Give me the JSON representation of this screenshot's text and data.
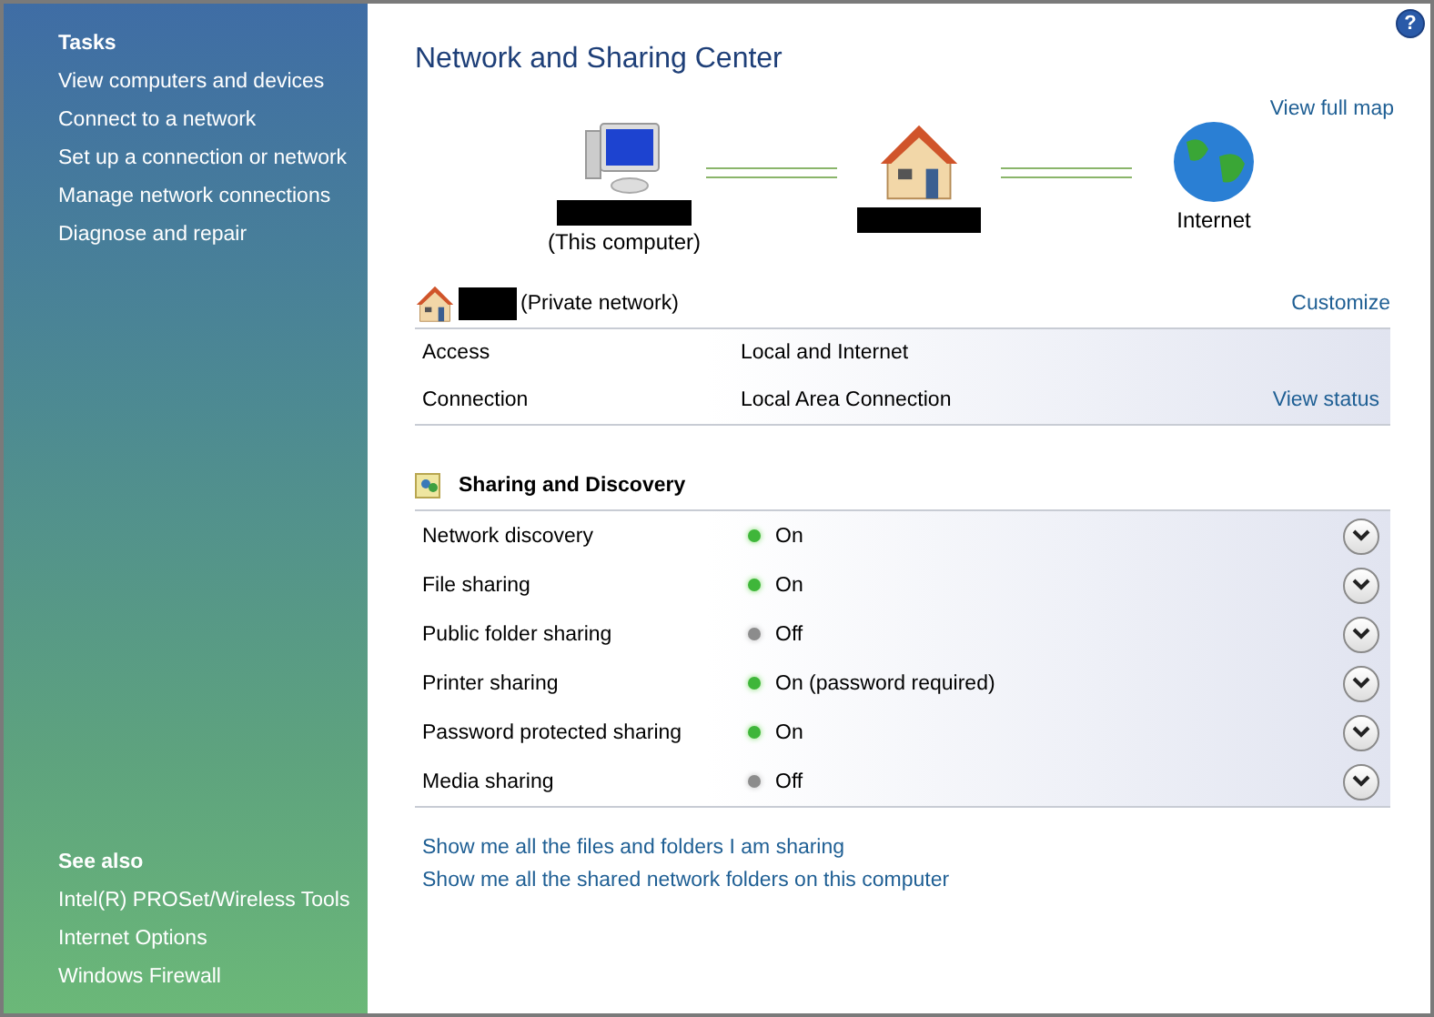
{
  "sidebar": {
    "tasks_heading": "Tasks",
    "tasks": [
      "View computers and devices",
      "Connect to a network",
      "Set up a connection or network",
      "Manage network connections",
      "Diagnose and repair"
    ],
    "see_also_heading": "See also",
    "see_also": [
      "Intel(R) PROSet/Wireless Tools",
      "Internet Options",
      "Windows Firewall"
    ]
  },
  "help": "?",
  "title": "Network and Sharing Center",
  "map": {
    "link": "View full map",
    "this_computer": "(This computer)",
    "internet": "Internet"
  },
  "network": {
    "type": "(Private network)",
    "customize": "Customize",
    "rows": [
      {
        "label": "Access",
        "value": "Local and Internet"
      },
      {
        "label": "Connection",
        "value": "Local Area Connection",
        "link": "View status"
      }
    ]
  },
  "sharing": {
    "heading": "Sharing and Discovery",
    "items": [
      {
        "label": "Network discovery",
        "status": "On",
        "on": true,
        "expanded": false
      },
      {
        "label": "File sharing",
        "status": "On",
        "on": true,
        "expanded": false
      },
      {
        "label": "Public folder sharing",
        "status": "Off",
        "on": false,
        "expanded": false
      },
      {
        "label": "Printer sharing",
        "status": "On (password required)",
        "on": true,
        "expanded": false
      },
      {
        "label": "Password protected sharing",
        "status": "On",
        "on": true,
        "expanded": false
      },
      {
        "label": "Media sharing",
        "status": "Off",
        "on": false,
        "expanded": false
      }
    ]
  },
  "links": [
    "Show me all the files and folders I am sharing",
    "Show me all the shared network folders on this computer"
  ]
}
